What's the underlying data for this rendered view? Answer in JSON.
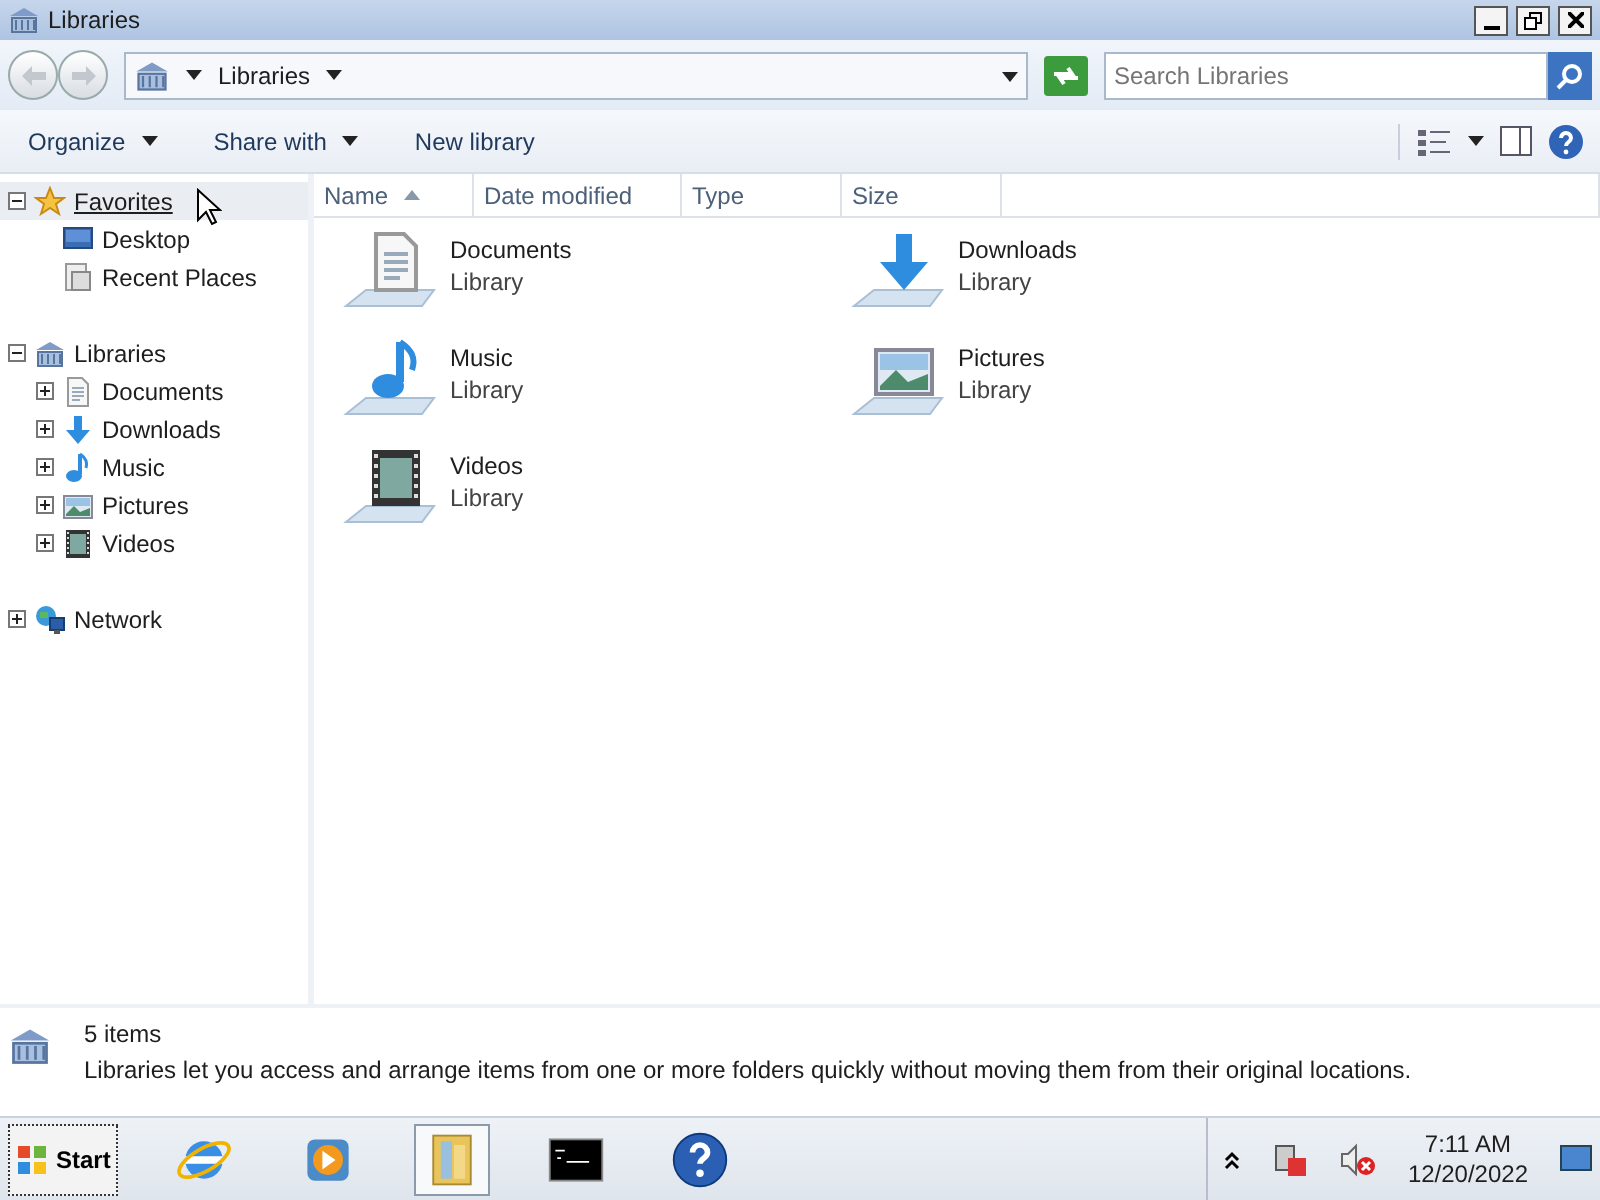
{
  "window": {
    "title": "Libraries"
  },
  "address": {
    "crumbs": [
      "Libraries"
    ],
    "search_placeholder": "Search Libraries"
  },
  "toolbar": [
    {
      "label": "Organize",
      "dropdown": true
    },
    {
      "label": "Share with",
      "dropdown": true
    },
    {
      "label": "New library",
      "dropdown": false
    }
  ],
  "nav": [
    {
      "label": "Favorites",
      "kind": "star",
      "expanded": true,
      "hovered": true,
      "children": [
        {
          "label": "Desktop",
          "kind": "desktop"
        },
        {
          "label": "Recent Places",
          "kind": "recent"
        }
      ]
    },
    {
      "label": "Libraries",
      "kind": "library",
      "expanded": true,
      "children": [
        {
          "label": "Documents",
          "kind": "documents",
          "expanded": false
        },
        {
          "label": "Downloads",
          "kind": "downloads",
          "expanded": false
        },
        {
          "label": "Music",
          "kind": "music",
          "expanded": false
        },
        {
          "label": "Pictures",
          "kind": "pictures",
          "expanded": false
        },
        {
          "label": "Videos",
          "kind": "videos",
          "expanded": false
        }
      ]
    },
    {
      "label": "Network",
      "kind": "network",
      "expanded": false
    }
  ],
  "columns": [
    {
      "label": "Name",
      "sorted": true
    },
    {
      "label": "Date modified",
      "sorted": false
    },
    {
      "label": "Type",
      "sorted": false
    },
    {
      "label": "Size",
      "sorted": false
    }
  ],
  "items": [
    {
      "name": "Documents",
      "type": "Library",
      "kind": "documents"
    },
    {
      "name": "Downloads",
      "type": "Library",
      "kind": "downloads"
    },
    {
      "name": "Music",
      "type": "Library",
      "kind": "music"
    },
    {
      "name": "Pictures",
      "type": "Library",
      "kind": "pictures"
    },
    {
      "name": "Videos",
      "type": "Library",
      "kind": "videos"
    }
  ],
  "details": {
    "count": "5 items",
    "description": "Libraries let you access and arrange items from one or more folders quickly without moving them from their original locations."
  },
  "taskbar": {
    "start": "Start",
    "apps": [
      {
        "kind": "browser",
        "selected": false
      },
      {
        "kind": "media",
        "selected": false
      },
      {
        "kind": "explorer",
        "selected": true
      },
      {
        "kind": "console",
        "selected": false
      },
      {
        "kind": "help",
        "selected": false
      }
    ],
    "time": "7:11 AM",
    "date": "12/20/2022"
  }
}
